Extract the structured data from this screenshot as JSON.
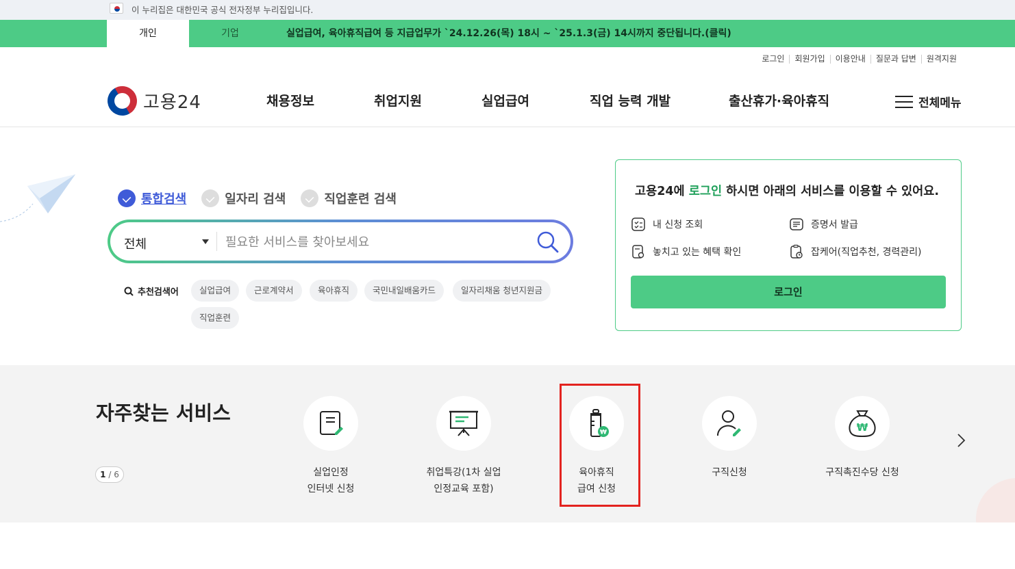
{
  "gov_bar": {
    "text": "이 누리집은 대한민국 공식 전자정부 누리집입니다."
  },
  "notice": {
    "tab_personal": "개인",
    "tab_business": "기업",
    "text": "실업급여, 육아휴직급여 등 지급업무가 `24.12.26(목) 18시 ~ `25.1.3(금) 14시까지 중단됩니다.(클릭)"
  },
  "util_links": [
    "로그인",
    "회원가입",
    "이용안내",
    "질문과 답변",
    "원격지원"
  ],
  "header": {
    "logo_text": "고용24",
    "nav": [
      "채용정보",
      "취업지원",
      "실업급여",
      "직업 능력 개발",
      "출산휴가·육아휴직"
    ],
    "all_menu": "전체메뉴"
  },
  "search": {
    "tabs": [
      "통합검색",
      "일자리 검색",
      "직업훈련 검색"
    ],
    "active_tab": "통합검색",
    "category": "전체",
    "placeholder": "필요한 서비스를 찾아보세요",
    "recommend_label": "추천검색어",
    "keywords": [
      "실업급여",
      "근로계약서",
      "육아휴직",
      "국민내일배움카드",
      "일자리채움 청년지원금",
      "직업훈련"
    ]
  },
  "login_box": {
    "msg_pre": "고용24에 ",
    "msg_hl": "로그인",
    "msg_post": " 하시면 아래의 서비스를 이용할 수 있어요.",
    "services": [
      "내 신청 조회",
      "증명서 발급",
      "놓치고 있는 혜택 확인",
      "잡케어(직업추천, 경력관리)"
    ],
    "button": "로그인"
  },
  "frequent": {
    "title": "자주찾는 서비스",
    "page_current": "1",
    "page_total": "/ 6",
    "items": [
      {
        "label": "실업인정\n인터넷 신청",
        "icon": "document-pen-icon"
      },
      {
        "label": "취업특강(1차 실업\n인정교육 포함)",
        "icon": "presentation-board-icon"
      },
      {
        "label": "육아휴직\n급여 신청",
        "icon": "baby-bottle-won-icon"
      },
      {
        "label": "구직신청",
        "icon": "person-pen-icon"
      },
      {
        "label": "구직촉진수당 신청",
        "icon": "money-bag-icon"
      }
    ]
  },
  "colors": {
    "brand_green": "#4dcb86",
    "accent_blue": "#3f5bd8",
    "highlight_red": "#e3231f"
  }
}
